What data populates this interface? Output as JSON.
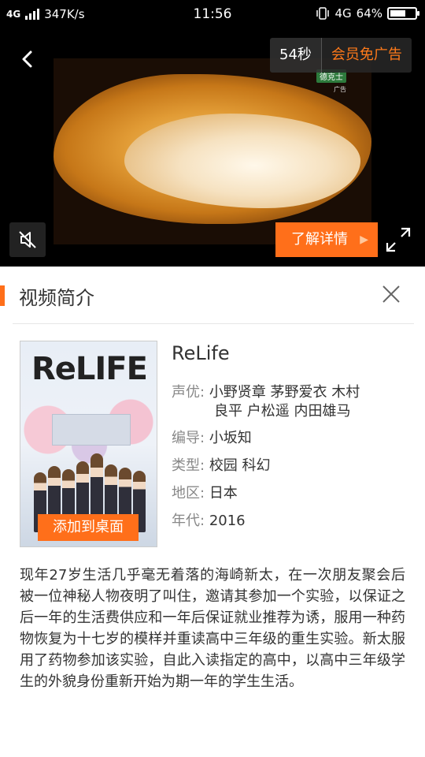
{
  "status_bar": {
    "network": "4G",
    "speed": "347K/s",
    "time": "11:56",
    "network_right": "4G",
    "battery": "64%",
    "battery_level": 0.64
  },
  "player": {
    "countdown": "54秒",
    "vip_label": "会员免广告",
    "detail_label": "了解详情",
    "ad_brand": "德克士",
    "ad_tag": "广告"
  },
  "intro": {
    "title": "视频简介"
  },
  "poster": {
    "logo": "ReLIFE",
    "add_desktop": "添加到桌面"
  },
  "info": {
    "title": "ReLife",
    "cast_label": "声优:",
    "cast_value_line1": "小野贤章  茅野爱衣  木村",
    "cast_value_line2": "良平  户松遥  内田雄马",
    "director_label": "编导:",
    "director_value": "小坂知",
    "genre_label": "类型:",
    "genre_value": "校园  科幻",
    "region_label": "地区:",
    "region_value": "日本",
    "year_label": "年代:",
    "year_value": "2016"
  },
  "synopsis": "现年27岁生活几乎毫无着落的海崎新太，在一次朋友聚会后被一位神秘人物夜明了叫住，邀请其参加一个实验，以保证之后一年的生活费供应和一年后保证就业推荐为诱，服用一种药物恢复为十七岁的模样并重读高中三年级的重生实验。新太服用了药物参加该实验，自此入读指定的高中，以高中三年级学生的外貌身份重新开始为期一年的学生生活。",
  "colors": {
    "accent": "#ff6f1a",
    "label": "#888888",
    "text": "#333333"
  }
}
